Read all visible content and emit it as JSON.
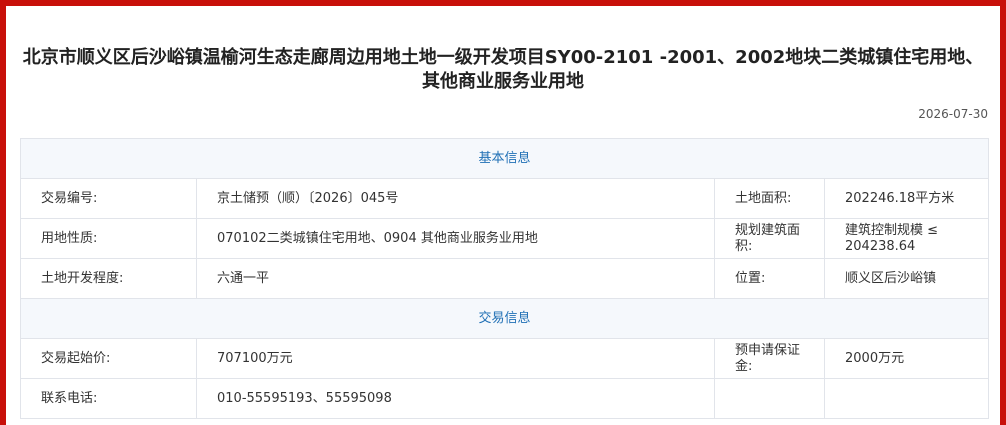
{
  "title": "北京市顺义区后沙峪镇温榆河生态走廊周边用地土地一级开发项目SY00-2101 -2001、2002地块二类城镇住宅用地、其他商业服务业用地",
  "date": "2026-07-30",
  "sections": {
    "basic": "基本信息",
    "trade": "交易信息"
  },
  "rows": {
    "trade_no_label": "交易编号:",
    "trade_no_value": "京土储预（顺）〔2026〕045号",
    "land_area_label": "土地面积:",
    "land_area_value": "202246.18平方米",
    "land_use_label": "用地性质:",
    "land_use_value": "070102二类城镇住宅用地、0904 其他商业服务业用地",
    "planned_area_label": "规划建筑面积:",
    "planned_area_value": "建筑控制规模 ≤ 204238.64",
    "dev_level_label": "土地开发程度:",
    "dev_level_value": "六通一平",
    "location_label": "位置:",
    "location_value": "顺义区后沙峪镇",
    "start_price_label": "交易起始价:",
    "start_price_value": "707100万元",
    "deposit_label": "预申请保证金:",
    "deposit_value": "2000万元",
    "phone_label": "联系电话:",
    "phone_value": "010-55595193、55595098"
  },
  "colors": {
    "frame": "#c8100a",
    "section_text": "#1f6fb5",
    "section_bg": "#f5f8fc",
    "border": "#e1e4ea"
  }
}
